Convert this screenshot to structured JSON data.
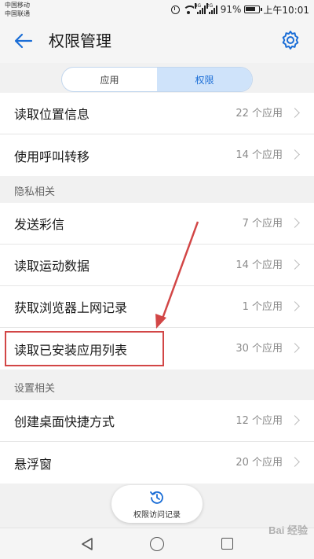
{
  "status_bar": {
    "carrier1": "中国移动",
    "carrier2": "中国联通",
    "signal1_tag": "4G",
    "signal2_tag": "2G",
    "battery": "91%",
    "time": "上午10:01"
  },
  "header": {
    "title": "权限管理"
  },
  "tabs": [
    {
      "label": "应用",
      "active": false
    },
    {
      "label": "权限",
      "active": true
    }
  ],
  "top_rows": [
    {
      "label": "读取位置信息",
      "count": "22 个应用"
    },
    {
      "label": "使用呼叫转移",
      "count": "14 个应用"
    }
  ],
  "privacy_section": {
    "title": "隐私相关",
    "rows": [
      {
        "label": "发送彩信",
        "count": "7 个应用"
      },
      {
        "label": "读取运动数据",
        "count": "14 个应用"
      },
      {
        "label": "获取浏览器上网记录",
        "count": "1 个应用"
      },
      {
        "label": "读取已安装应用列表",
        "count": "30 个应用"
      }
    ]
  },
  "settings_section": {
    "title": "设置相关",
    "rows": [
      {
        "label": "创建桌面快捷方式",
        "count": "12 个应用"
      },
      {
        "label": "悬浮窗",
        "count": "20 个应用"
      }
    ]
  },
  "history_button": {
    "label": "权限访问记录"
  },
  "watermark": "Bai 经验",
  "colors": {
    "accent": "#1a6dd6",
    "highlight": "#d24646"
  }
}
